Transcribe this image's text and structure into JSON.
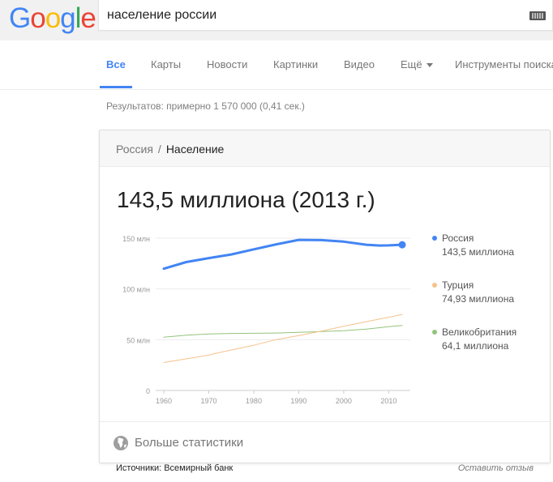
{
  "logo": {
    "letters": [
      "G",
      "o",
      "o",
      "g",
      "l",
      "e"
    ],
    "colors": [
      "#4285f4",
      "#ea4335",
      "#fbbc05",
      "#4285f4",
      "#34a853",
      "#ea4335"
    ]
  },
  "search": {
    "query": "население россии",
    "keyboard_icon": "keyboard-icon"
  },
  "tabs": [
    {
      "label": "Все",
      "active": true
    },
    {
      "label": "Карты"
    },
    {
      "label": "Новости"
    },
    {
      "label": "Картинки"
    },
    {
      "label": "Видео"
    },
    {
      "label": "Ещё"
    },
    {
      "label": "Инструменты поиска"
    }
  ],
  "results_stats": "Результатов: примерно 1 570 000 (0,41 сек.)",
  "card": {
    "breadcrumb": {
      "parent": "Россия",
      "separator": "/",
      "current": "Население"
    },
    "headline": "143,5 миллиона (2013 г.)",
    "more_stats": "Больше статистики",
    "globe_icon": "globe-icon"
  },
  "sources": "Источники: Всемирный банк",
  "feedback": "Оставить отзыв",
  "chart_data": {
    "type": "line",
    "x": [
      1960,
      1965,
      1970,
      1975,
      1980,
      1985,
      1990,
      1995,
      2000,
      2005,
      2008,
      2010,
      2013
    ],
    "xticks": [
      "1960",
      "1970",
      "1980",
      "1990",
      "2000",
      "2010"
    ],
    "yticks": [
      "0",
      "50 млн",
      "100 млн",
      "150 млн"
    ],
    "ylim": [
      0,
      150
    ],
    "xlim": [
      1960,
      2013
    ],
    "grid": true,
    "legend_position": "right",
    "series": [
      {
        "name": "Россия",
        "value_label": "143,5 миллиона",
        "color": "#4285f4",
        "values": [
          119.9,
          126.5,
          130.4,
          134.0,
          139.0,
          143.9,
          148.3,
          148.1,
          146.6,
          143.5,
          142.7,
          142.9,
          143.5
        ]
      },
      {
        "name": "Турция",
        "value_label": "74,93 миллиона",
        "color": "#f6c28b",
        "values": [
          27.5,
          31.1,
          34.9,
          39.9,
          44.5,
          50.1,
          54.1,
          58.4,
          63.2,
          67.7,
          70.4,
          72.1,
          74.9
        ]
      },
      {
        "name": "Великобритания",
        "value_label": "64,1 миллиона",
        "color": "#93c47d",
        "values": [
          52.4,
          54.4,
          55.6,
          56.2,
          56.3,
          56.6,
          57.2,
          58.0,
          58.9,
          60.4,
          61.8,
          62.8,
          64.1
        ]
      }
    ]
  }
}
